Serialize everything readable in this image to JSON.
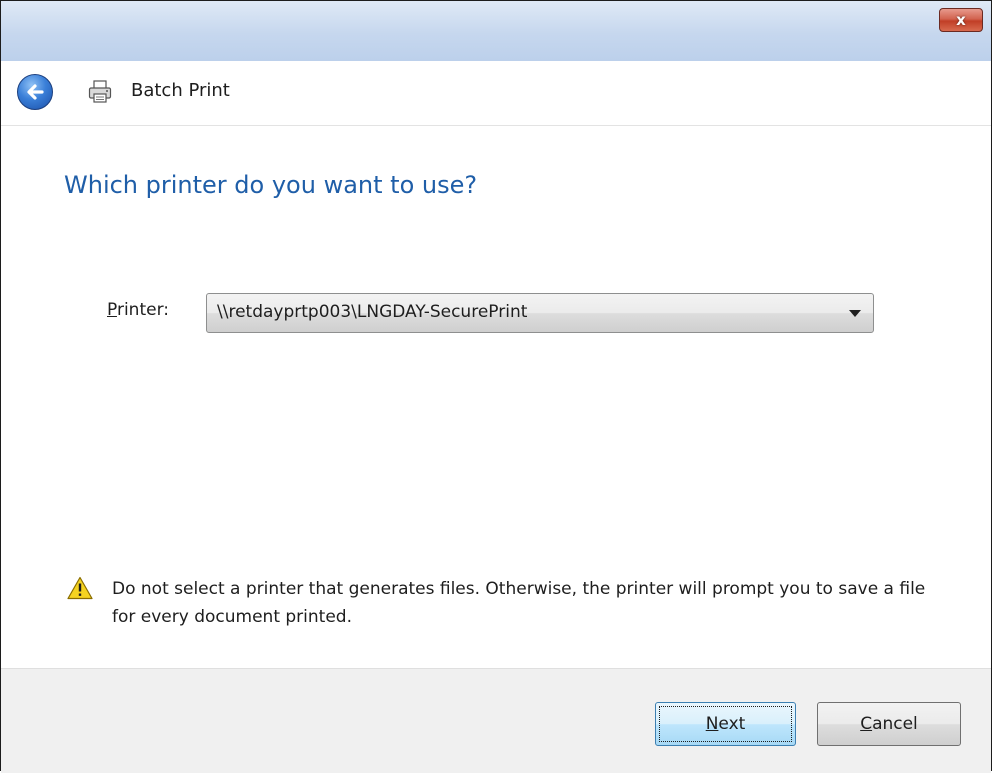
{
  "window": {
    "close_glyph": "x"
  },
  "nav": {
    "title": "Batch Print",
    "back_icon": "back-arrow-icon",
    "title_icon": "printer-icon"
  },
  "main": {
    "heading": "Which printer do you want to use?",
    "printer_label_accel": "P",
    "printer_label_rest": "rinter:",
    "printer_value": "\\\\retdayprtp003\\LNGDAY-SecurePrint",
    "warning_icon": "warning-icon",
    "warning_text": "Do not select a printer that generates files.  Otherwise, the printer will prompt you to save a file for every document printed."
  },
  "footer": {
    "next_accel": "N",
    "next_rest": "ext",
    "cancel_accel": "C",
    "cancel_rest": "ancel"
  },
  "colors": {
    "heading": "#1f5ea8",
    "titlebar": "#c6d7ee",
    "close_button": "#c13e26",
    "footer": "#f0f0f0"
  }
}
